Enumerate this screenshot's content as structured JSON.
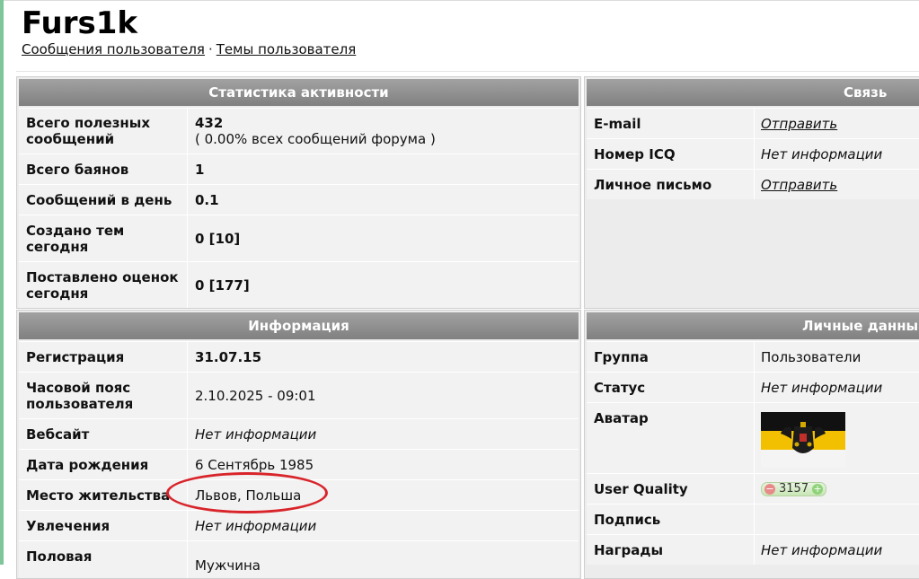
{
  "profile": {
    "username": "Furs1k",
    "links": {
      "posts": "Сообщения пользователя",
      "separator": "·",
      "topics": "Темы пользователя"
    }
  },
  "activity": {
    "title": "Статистика активности",
    "rows": [
      {
        "label_1": "Всего полезных",
        "label_2": "сообщений",
        "value": "432",
        "subvalue": "( 0.00% всех сообщений форума )"
      },
      {
        "label": "Всего баянов",
        "value": "1"
      },
      {
        "label": "Сообщений в день",
        "value": "0.1"
      },
      {
        "label_1": "Создано тем",
        "label_2": "сегодня",
        "value": "0 [10]"
      },
      {
        "label_1": "Поставлено оценок",
        "label_2": "сегодня",
        "value": "0 [177]"
      }
    ]
  },
  "contact": {
    "title": "Связь",
    "rows": [
      {
        "label": "E-mail",
        "value": "Отправить"
      },
      {
        "label": "Номер ICQ",
        "value": "Нет информации"
      },
      {
        "label": "Личное письмо",
        "value": "Отправить"
      }
    ]
  },
  "info": {
    "title": "Информация",
    "rows": [
      {
        "label": "Регистрация",
        "value": "31.07.15"
      },
      {
        "label_1": "Часовой пояс",
        "label_2": "пользователя",
        "value": "2.10.2025 - 09:01"
      },
      {
        "label": "Вебсайт",
        "value": "Нет информации"
      },
      {
        "label": "Дата рождения",
        "value": "6 Сентябрь 1985"
      },
      {
        "label": "Место жительства",
        "value": "Львов, Польша"
      },
      {
        "label": "Увлечения",
        "value": "Нет информации"
      },
      {
        "label": "Половая",
        "value": "Мужчина"
      }
    ]
  },
  "personal": {
    "title": "Личные данны",
    "rows": [
      {
        "label": "Группа",
        "value": "Пользователи"
      },
      {
        "label": "Статус",
        "value": "Нет информации"
      },
      {
        "label": "Аватар",
        "value": "flag-avatar"
      },
      {
        "label": "User Quality",
        "value": "3157",
        "minus": "−",
        "plus": "+"
      },
      {
        "label": "Подпись",
        "value": ""
      },
      {
        "label": "Награды",
        "value": "Нет информации"
      }
    ]
  },
  "colors": {
    "header_bg": "#8f8f8f",
    "annotation": "#d8242a",
    "left_stripe": "#7fc59a"
  }
}
